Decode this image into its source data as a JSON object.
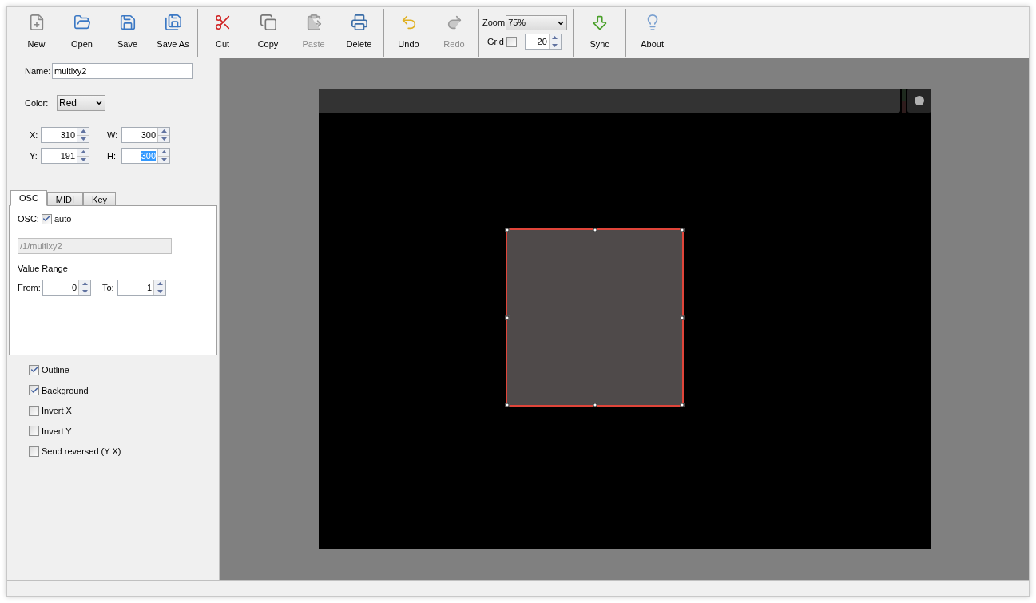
{
  "toolbar": {
    "groups": [
      {
        "buttons": [
          {
            "label": "New",
            "disabled": false
          },
          {
            "label": "Open",
            "disabled": false
          },
          {
            "label": "Save",
            "disabled": false
          },
          {
            "label": "Save As",
            "disabled": false
          }
        ]
      },
      {
        "buttons": [
          {
            "label": "Cut",
            "disabled": false
          },
          {
            "label": "Copy",
            "disabled": false
          },
          {
            "label": "Paste",
            "disabled": true
          },
          {
            "label": "Delete",
            "disabled": false
          }
        ]
      },
      {
        "buttons": [
          {
            "label": "Undo",
            "disabled": false
          },
          {
            "label": "Redo",
            "disabled": true
          }
        ]
      }
    ],
    "zoom": {
      "label": "Zoom",
      "value": "75%"
    },
    "grid": {
      "label": "Grid",
      "checked": false,
      "value": "20"
    },
    "extra": [
      {
        "label": "Sync",
        "disabled": false
      },
      {
        "label": "About",
        "disabled": false
      }
    ]
  },
  "properties": {
    "name": {
      "label": "Name:",
      "value": "multixy2"
    },
    "color": {
      "label": "Color:",
      "value": "Red"
    },
    "geometry": [
      {
        "label": "X:",
        "value": "310",
        "selected": false
      },
      {
        "label": "W:",
        "value": "300",
        "selected": false
      },
      {
        "label": "Y:",
        "value": "191",
        "selected": false
      },
      {
        "label": "H:",
        "value": "300",
        "selected": true
      }
    ],
    "tabs": [
      {
        "label": "OSC",
        "selected": true
      },
      {
        "label": "MIDI",
        "selected": false
      },
      {
        "label": "Key",
        "selected": false
      }
    ],
    "osc": {
      "label": "OSC:",
      "auto": {
        "label": "auto",
        "checked": true
      },
      "address": "/1/multixy2",
      "range_title": "Value Range",
      "from": {
        "label": "From:",
        "value": "0"
      },
      "to": {
        "label": "To:",
        "value": "1"
      }
    },
    "options": [
      {
        "label": "Outline",
        "checked": true
      },
      {
        "label": "Background",
        "checked": true
      },
      {
        "label": "Invert X",
        "checked": false
      },
      {
        "label": "Invert Y",
        "checked": false
      },
      {
        "label": "Send reversed (Y X)",
        "checked": false
      }
    ]
  },
  "canvas": {
    "widget": {
      "selected": true
    }
  }
}
